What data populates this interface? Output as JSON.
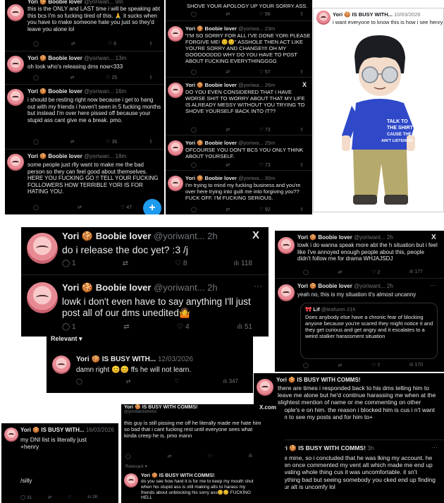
{
  "p1": {
    "name": "Yori 🍪 Boobie lover",
    "handle": "@yoriwan...",
    "t1": {
      "time": "9m",
      "body": "this is the ONLY and LAST time i will be speaking abt this bcs I'm so fucking tired of this. 🙏 it sucks when you have to make someone hate you just so they'd leave you alone lol",
      "stats": [
        "",
        "",
        "6",
        ""
      ]
    },
    "t2": {
      "time": "13m",
      "body": "oh look who's releasing dms now<333",
      "stats": [
        "",
        "",
        "25",
        ""
      ]
    },
    "t3": {
      "time": "16m",
      "body": "i should be resting right now because i get to hang out with my friends i haven't seen in 5 fucking months but instead I'm over here pissed off because your stupid ass cant give me a break. pmo.",
      "stats": [
        "",
        "",
        "36",
        ""
      ]
    },
    "t4": {
      "time": "18m",
      "body": "some people just rlly want to make me the bad person so they can feel good about themselves. HERE YOU FUCKING GO !! TELL YOUR FUCKING FOLLOWERS HOW TERRIBLE YORI IS FOR HATING YOU.",
      "stats": [
        "",
        "",
        "47",
        ""
      ]
    },
    "fab": "+"
  },
  "p2": {
    "name": "Yori 🍪 Boobie lover",
    "handle": "@yoriwa...",
    "t0": {
      "body": "SHOVE YOUR APOLOGY UP YOUR SORRY ASS.",
      "stats": [
        "",
        "",
        "56",
        ""
      ]
    },
    "t1": {
      "time": "23m",
      "body": "\"I'M SO SORRY FOR ALL I'VE DONE YORI PLEASE FORGIVE ME! 😊😊\" ASSHOLE THEN ACT LIKE YOU'RE SORRY AND CHANGE!!!! OH MY GOOOOODDD WHY DO YOU HAVE TO POST ABOUT FUCKING EVERYTHINGGGG",
      "stats": [
        "",
        "",
        "57",
        ""
      ]
    },
    "t2": {
      "time": "26m",
      "body": "DO YOU EVEN CONSIDERED THAT I HAVE WORSE SHIT TO WORRY ABOUT THAT MY LIFE IS ALREADY MESSY WITHOUT YOU TRYING TO SHOVE YOURSELF BACK INTO IT??",
      "stats": [
        "",
        "",
        "73",
        ""
      ]
    },
    "t3": {
      "time": "25m",
      "body": "OFCOURSE YOU DON'T BCS YOU ONLY THINK ABOUT YOURSELF.",
      "stats": [
        "",
        "",
        "73",
        ""
      ]
    },
    "t4": {
      "time": "30m",
      "body": "I'm trying to mind my fucking business and you're over here trying into guilt me into forgiving you?? FUCK OFF. I'M FUCKING SERIOUS.",
      "stats": [
        "",
        "",
        "92",
        ""
      ]
    }
  },
  "p3": {
    "name": "Yori 🍪 IS BUSY WITH...",
    "time": "10/03/2026",
    "body": "i want everyone to know this is how i see henry",
    "shirt": [
      "TALK TO",
      "THE SHIRT",
      "CAUSE THE",
      "AIN'T LISTENING"
    ]
  },
  "p4": {
    "name": "Yori 🍪 Boobie lover",
    "handle": "@yoriwant...",
    "time": "2h",
    "t1": {
      "body": "do i release the doc yet? :3 /j",
      "stats": [
        "1",
        "",
        "8",
        "118"
      ]
    },
    "t2": {
      "body": "lowk i don't even have to say anything I'll just post all of our dms unedited🤷",
      "stats": [
        "1",
        "",
        "4",
        "51"
      ]
    }
  },
  "p5": {
    "relevant": "Relevant ▾",
    "name": "Yori 🍪 IS BUSY WITH...",
    "time": "12/03/2026",
    "body": "damn right 😊😊 ffs he will not learn.",
    "stats": [
      "",
      "",
      "",
      "347"
    ]
  },
  "p6": {
    "name": "Yori 🍪 Boobie lover",
    "handle": "@yoriwant...",
    "time": "2h",
    "t1": {
      "body": "lowk i do wanna speak more abt the h situation but i feel like I've annoyed enough people about this, people didn't follow me for drama WHJAJSDJ",
      "stats": [
        "",
        "",
        "2",
        "177"
      ]
    },
    "t2": {
      "body": "yeah no, this is my situation it's almost uncanny",
      "stats": [
        "",
        "",
        "7",
        "170"
      ]
    },
    "quote": {
      "name": "🎀 Lif",
      "handle": "@leafumn",
      "time": "21h",
      "body": "Does anybody else have a chronic fear of blocking anyone because you're scared they might notice it and they get curious and get angry and it escalates to a weird stalker harassment situation"
    }
  },
  "p7": {
    "name": "Yori 🍪 IS BUSY WITH COMMS!",
    "time": "3h",
    "t1": {
      "body": "there are times i responded back to his dms telling him to leave me alone but he'd continue harassing me when at the slightest mention of name or me commenting on other people's e on him. the reason i blocked him is cus i n't want him to see my posts and for him to+"
    },
    "t2": {
      "body": "see mine, so i concluded that he was lking my account. he even once commented my vent alt which made me end up privating whole thing cus it was uncomfortable. it sn't anything bad but seeing somebody you cked end up finding your alt is uncomfy lol"
    }
  },
  "p8": {
    "top": "@yoriwantsbrkfst",
    "name": "Yori 🍪 IS BUSY WITH COMMS!",
    "site": "X.com",
    "t1": {
      "body": "this guy is still pissing me off he literally made me hate him so bad that i cant fucking rest until everyone sees what kinda creep he is. pmo mann"
    },
    "relevant": "Relevant ▾",
    "t2": {
      "body": "do you see how hard it is for me to keep my mouth shut when his stupid ass is still making alts to harass my friends about unblocking his sorry ass😊😊 FUCKING HELL"
    }
  },
  "p9": {
    "name": "Yori 🍪 IS BUSY WITH...",
    "time": "16/03/2026",
    "body": "my DNI list is literally just +henry",
    "body2": "/silly",
    "stats": [
      "31",
      "",
      "",
      "2K"
    ]
  },
  "icons": [
    "reply-icon",
    "retweet-icon",
    "like-icon",
    "views-icon",
    "more-icon",
    "x-logo-icon"
  ]
}
